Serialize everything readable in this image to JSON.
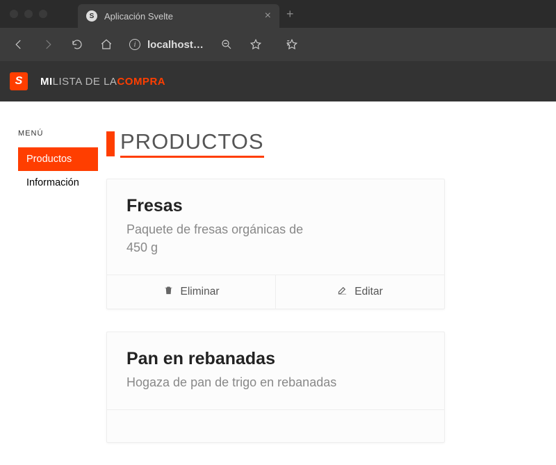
{
  "browser": {
    "tab_title": "Aplicación Svelte",
    "url": "localhost…"
  },
  "header": {
    "brand_mi": "MI",
    "brand_lista": "LISTA DE LA",
    "brand_compra": "COMPRA"
  },
  "sidebar": {
    "menu_label": "MENÚ",
    "items": [
      {
        "label": "Productos"
      },
      {
        "label": "Información"
      }
    ]
  },
  "main": {
    "page_title": "PRODUCTOS",
    "products": [
      {
        "name": "Fresas",
        "description": "Paquete de fresas orgánicas de 450 g"
      },
      {
        "name": "Pan en rebanadas",
        "description": "Hogaza de pan de trigo en rebanadas"
      }
    ],
    "delete_label": "Eliminar",
    "edit_label": "Editar"
  }
}
